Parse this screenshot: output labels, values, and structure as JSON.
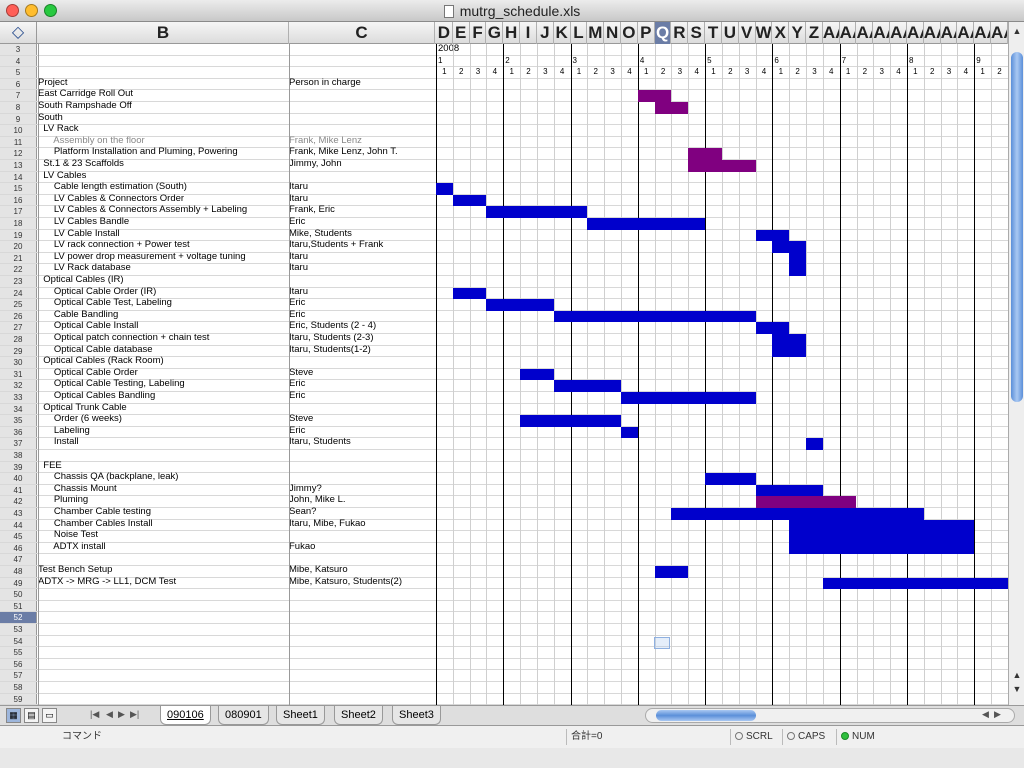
{
  "window": {
    "title": "mutrg_schedule.xls"
  },
  "corner_icon": "select-all-diamond-icon",
  "col_letters": [
    "D",
    "E",
    "F",
    "G",
    "H",
    "I",
    "J",
    "K",
    "L",
    "M",
    "N",
    "O",
    "P",
    "Q",
    "R",
    "S",
    "T",
    "U",
    "V",
    "W",
    "X",
    "Y",
    "Z",
    "A",
    "A",
    "A",
    "A",
    "A",
    "A",
    "A",
    "A",
    "A",
    "A",
    "A",
    "A",
    "A"
  ],
  "col_letters_suffix": [
    "",
    "",
    "",
    "",
    "",
    "",
    "",
    "",
    "",
    "",
    "",
    "",
    "",
    "",
    "",
    "",
    "",
    "",
    "",
    "",
    "",
    "",
    "",
    "A",
    "A",
    "A",
    "A",
    "A",
    "A",
    "A",
    "A",
    "A",
    "A",
    "A",
    "A",
    "A"
  ],
  "selected_col": "Q",
  "col_b": "B",
  "col_c": "C",
  "year": "2008",
  "months": [
    "1",
    "2",
    "3",
    "4",
    "5",
    "6",
    "7",
    "8",
    "9"
  ],
  "weeks": [
    "1",
    "2",
    "3",
    "4",
    "1",
    "2",
    "3",
    "4",
    "1",
    "2",
    "3",
    "4",
    "1",
    "2",
    "3",
    "4",
    "1",
    "2",
    "3",
    "4",
    "1",
    "2",
    "3",
    "4",
    "1",
    "2",
    "3",
    "4",
    "1",
    "2",
    "3",
    "4",
    "1",
    "2"
  ],
  "rows": [
    {
      "n": "3",
      "b": "",
      "c": ""
    },
    {
      "n": "4",
      "b": "",
      "c": ""
    },
    {
      "n": "5",
      "b": "",
      "c": ""
    },
    {
      "n": "6",
      "b": "Project",
      "c": "Person in charge"
    },
    {
      "n": "7",
      "b": "East Carridge Roll Out",
      "c": ""
    },
    {
      "n": "8",
      "b": "South Rampshade Off",
      "c": ""
    },
    {
      "n": "9",
      "b": "South",
      "c": ""
    },
    {
      "n": "10",
      "b": "  LV Rack",
      "c": ""
    },
    {
      "n": "11",
      "b": "      Assembly on the floor",
      "c": "Frank, Mike Lenz",
      "gray": true
    },
    {
      "n": "12",
      "b": "      Platform Installation and Pluming, Powering",
      "c": "Frank, Mike Lenz, John T."
    },
    {
      "n": "13",
      "b": "  St.1 & 23 Scaffolds",
      "c": "Jimmy, John"
    },
    {
      "n": "14",
      "b": "  LV Cables",
      "c": ""
    },
    {
      "n": "15",
      "b": "      Cable length estimation (South)",
      "c": "Itaru"
    },
    {
      "n": "16",
      "b": "      LV Cables & Connectors Order",
      "c": "Itaru"
    },
    {
      "n": "17",
      "b": "      LV Cables & Connectors Assembly + Labeling",
      "c": "Frank, Eric"
    },
    {
      "n": "18",
      "b": "      LV Cables Bandle",
      "c": "Eric"
    },
    {
      "n": "19",
      "b": "      LV Cable Install",
      "c": "Mike, Students"
    },
    {
      "n": "20",
      "b": "      LV rack connection + Power test",
      "c": "Itaru,Students + Frank"
    },
    {
      "n": "21",
      "b": "      LV power drop measurement + voltage tuning",
      "c": "Itaru"
    },
    {
      "n": "22",
      "b": "      LV Rack database",
      "c": "Itaru"
    },
    {
      "n": "23",
      "b": "  Optical Cables (IR)",
      "c": ""
    },
    {
      "n": "24",
      "b": "      Optical Cable Order (IR)",
      "c": "Itaru"
    },
    {
      "n": "25",
      "b": "      Optical Cable Test, Labeling",
      "c": "Eric"
    },
    {
      "n": "26",
      "b": "      Cable Bandling",
      "c": "Eric"
    },
    {
      "n": "27",
      "b": "      Optical Cable Install",
      "c": "Eric, Students  (2 - 4)"
    },
    {
      "n": "28",
      "b": "      Optical patch connection + chain test",
      "c": "Itaru, Students (2-3)"
    },
    {
      "n": "29",
      "b": "      Optical Cable database",
      "c": "Itaru, Students(1-2)"
    },
    {
      "n": "30",
      "b": "  Optical Cables (Rack Room)",
      "c": ""
    },
    {
      "n": "31",
      "b": "      Optical Cable Order",
      "c": "Steve"
    },
    {
      "n": "32",
      "b": "      Optical Cable Testing, Labeling",
      "c": "Eric"
    },
    {
      "n": "33",
      "b": "      Optical Cables Bandling",
      "c": "Eric"
    },
    {
      "n": "34",
      "b": "  Optical Trunk Cable",
      "c": ""
    },
    {
      "n": "35",
      "b": "      Order (6 weeks)",
      "c": "Steve"
    },
    {
      "n": "36",
      "b": "      Labeling",
      "c": "Eric"
    },
    {
      "n": "37",
      "b": "      Install",
      "c": "Itaru, Students"
    },
    {
      "n": "38",
      "b": "",
      "c": ""
    },
    {
      "n": "39",
      "b": "  FEE",
      "c": ""
    },
    {
      "n": "40",
      "b": "      Chassis QA (backplane, leak)",
      "c": ""
    },
    {
      "n": "41",
      "b": "      Chassis Mount",
      "c": "Jimmy?"
    },
    {
      "n": "42",
      "b": "      Pluming",
      "c": "John, Mike L."
    },
    {
      "n": "43",
      "b": "      Chamber Cable testing",
      "c": "Sean?"
    },
    {
      "n": "44",
      "b": "      Chamber Cables Install",
      "c": "Itaru, Mibe, Fukao"
    },
    {
      "n": "45",
      "b": "      Noise Test",
      "c": ""
    },
    {
      "n": "46",
      "b": "      ADTX install",
      "c": "Fukao"
    },
    {
      "n": "47",
      "b": "",
      "c": ""
    },
    {
      "n": "48",
      "b": "Test Bench Setup",
      "c": "Mibe, Katsuro"
    },
    {
      "n": "49",
      "b": "ADTX -> MRG -> LL1, DCM Test",
      "c": "Mibe, Katsuro, Students(2)"
    },
    {
      "n": "50",
      "b": "",
      "c": ""
    },
    {
      "n": "51",
      "b": "",
      "c": ""
    },
    {
      "n": "52",
      "b": "",
      "c": "",
      "sel": true
    },
    {
      "n": "53",
      "b": "",
      "c": ""
    },
    {
      "n": "54",
      "b": "",
      "c": ""
    },
    {
      "n": "55",
      "b": "",
      "c": ""
    },
    {
      "n": "56",
      "b": "",
      "c": ""
    },
    {
      "n": "57",
      "b": "",
      "c": ""
    },
    {
      "n": "58",
      "b": "",
      "c": ""
    },
    {
      "n": "59",
      "b": "",
      "c": ""
    }
  ],
  "colors": {
    "blue": "#0000cc",
    "purple": "#800080",
    "selected": "#6b7da6"
  },
  "gantt": [
    {
      "row": "7",
      "start": 13,
      "end": 14,
      "color": "purple"
    },
    {
      "row": "8",
      "start": 14,
      "end": 15,
      "color": "purple"
    },
    {
      "row": "12",
      "start": 16,
      "end": 17,
      "color": "purple"
    },
    {
      "row": "13",
      "start": 16,
      "end": 19,
      "color": "purple"
    },
    {
      "row": "15",
      "start": 1,
      "end": 1,
      "color": "blue"
    },
    {
      "row": "16",
      "start": 2,
      "end": 3,
      "color": "blue"
    },
    {
      "row": "17",
      "start": 4,
      "end": 9,
      "color": "blue"
    },
    {
      "row": "18",
      "start": 10,
      "end": 16,
      "color": "blue"
    },
    {
      "row": "19",
      "start": 20,
      "end": 21,
      "color": "blue"
    },
    {
      "row": "20",
      "start": 21,
      "end": 22,
      "color": "blue"
    },
    {
      "row": "21",
      "start": 22,
      "end": 22,
      "color": "blue"
    },
    {
      "row": "22",
      "start": 22,
      "end": 22,
      "color": "blue"
    },
    {
      "row": "24",
      "start": 2,
      "end": 3,
      "color": "blue"
    },
    {
      "row": "25",
      "start": 4,
      "end": 7,
      "color": "blue"
    },
    {
      "row": "26",
      "start": 8,
      "end": 19,
      "color": "blue"
    },
    {
      "row": "27",
      "start": 20,
      "end": 21,
      "color": "blue"
    },
    {
      "row": "28",
      "start": 21,
      "end": 22,
      "color": "blue"
    },
    {
      "row": "29",
      "start": 21,
      "end": 22,
      "color": "blue"
    },
    {
      "row": "31",
      "start": 6,
      "end": 7,
      "color": "blue"
    },
    {
      "row": "32",
      "start": 8,
      "end": 11,
      "color": "blue"
    },
    {
      "row": "33",
      "start": 12,
      "end": 19,
      "color": "blue"
    },
    {
      "row": "35",
      "start": 6,
      "end": 11,
      "color": "blue"
    },
    {
      "row": "36",
      "start": 12,
      "end": 12,
      "color": "blue"
    },
    {
      "row": "37",
      "start": 23,
      "end": 23,
      "color": "blue"
    },
    {
      "row": "40",
      "start": 17,
      "end": 19,
      "color": "blue"
    },
    {
      "row": "41",
      "start": 20,
      "end": 23,
      "color": "blue"
    },
    {
      "row": "42",
      "start": 20,
      "end": 23,
      "color": "purple"
    },
    {
      "row": "42",
      "start": 24,
      "end": 25,
      "color": "purple"
    },
    {
      "row": "43",
      "start": 15,
      "end": 29,
      "color": "blue"
    },
    {
      "row": "44",
      "start": 22,
      "end": 32,
      "color": "blue"
    },
    {
      "row": "45",
      "start": 22,
      "end": 32,
      "color": "blue"
    },
    {
      "row": "46",
      "start": 22,
      "end": 32,
      "color": "blue"
    },
    {
      "row": "48",
      "start": 14,
      "end": 15,
      "color": "blue"
    },
    {
      "row": "49",
      "start": 24,
      "end": 34,
      "color": "blue"
    }
  ],
  "tabs": [
    "090106",
    "080901",
    "Sheet1",
    "Sheet2",
    "Sheet3"
  ],
  "active_tab": "090106",
  "status": {
    "mode": "コマンド",
    "sum": "合計=0",
    "scrl": "SCRL",
    "caps": "CAPS",
    "num": "NUM"
  }
}
